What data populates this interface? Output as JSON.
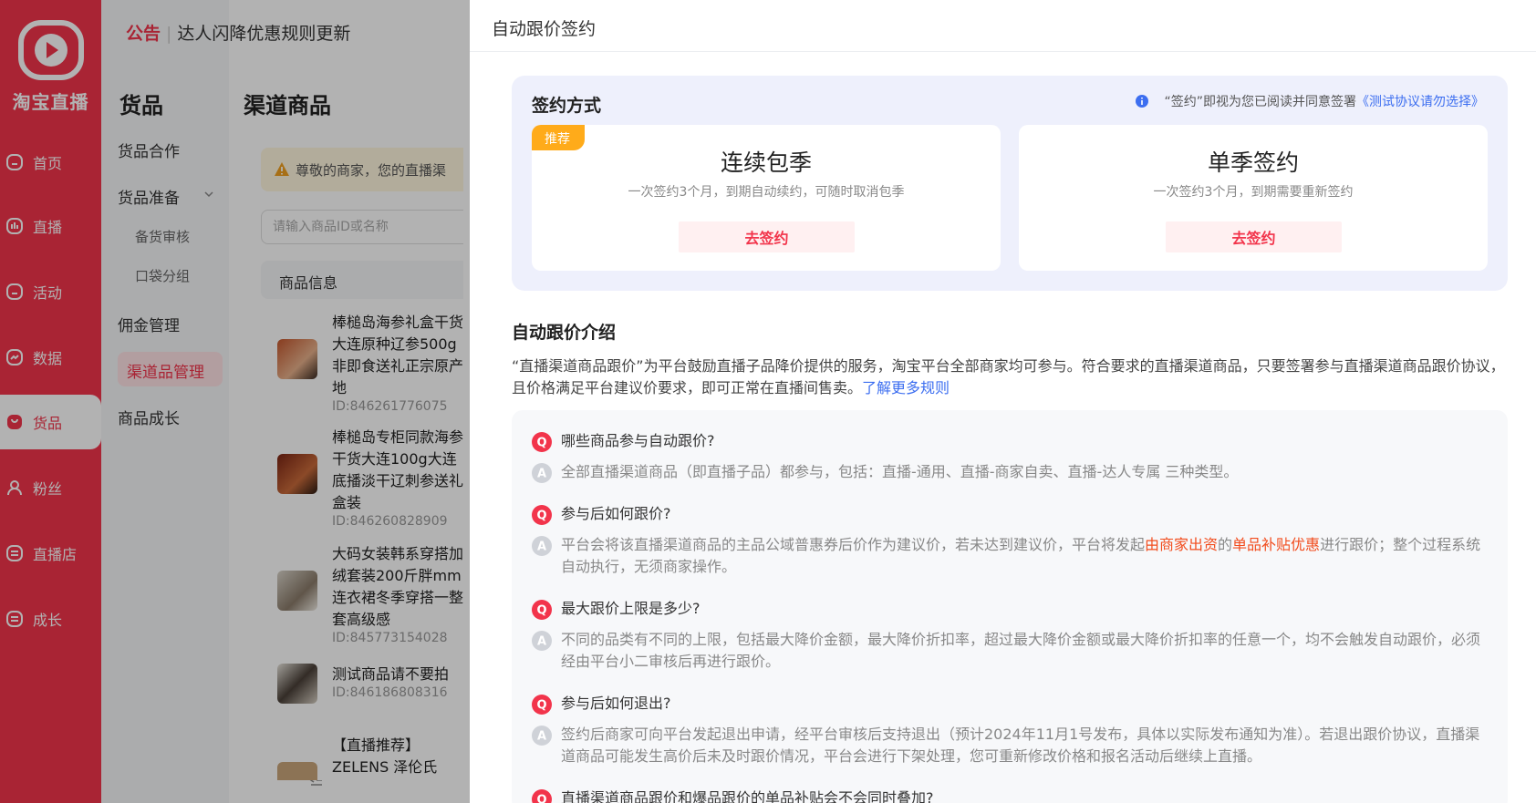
{
  "nav": {
    "brand": "淘宝直播",
    "items": [
      {
        "label": "首页",
        "icon": "home-icon"
      },
      {
        "label": "直播",
        "icon": "live-icon"
      },
      {
        "label": "活动",
        "icon": "activity-icon"
      },
      {
        "label": "数据",
        "icon": "data-icon"
      },
      {
        "label": "货品",
        "icon": "goods-icon"
      },
      {
        "label": "粉丝",
        "icon": "fans-icon"
      },
      {
        "label": "直播店",
        "icon": "store-icon"
      },
      {
        "label": "成长",
        "icon": "growth-icon"
      }
    ]
  },
  "sub": {
    "title": "货品",
    "items": [
      "货品合作",
      "货品准备",
      "备货审核",
      "口袋分组",
      "佣金管理",
      "渠道品管理",
      "商品成长"
    ]
  },
  "notice": {
    "tag": "公告",
    "text": "达人闪降优惠规则更新"
  },
  "middle": {
    "title": "渠道商品",
    "alert": "尊敬的商家，您的直播渠",
    "search_placeholder": "请输入商品ID或名称",
    "list_header": "商品信息",
    "products": [
      {
        "name": "棒槌岛海参礼盒干货大连原种辽参500g非即食送礼正宗原产地",
        "id": "ID:846261776075"
      },
      {
        "name": "棒槌岛专柜同款海参干货大连100g大连底播淡干辽刺参送礼盒装",
        "id": "ID:846260828909"
      },
      {
        "name": "大码女装韩系穿搭加绒套装200斤胖mm连衣裙冬季穿搭一整套高级感",
        "id": "ID:845773154028"
      },
      {
        "name": "测试商品请不要拍",
        "id": "ID:846186808316"
      },
      {
        "name": "【直播推荐】ZELENS 泽伦氏",
        "id": ""
      }
    ]
  },
  "drawer": {
    "title": "自动跟价签约",
    "sign_title": "签约方式",
    "agree_text": "“签约”即视为您已阅读并同意签署",
    "agree_link": "《测试协议请勿选择》",
    "cards": [
      {
        "badge": "推荐",
        "title": "连续包季",
        "desc": "一次签约3个月，到期自动续约，可随时取消包季",
        "button": "去签约"
      },
      {
        "badge": "",
        "title": "单季签约",
        "desc": "一次签约3个月，到期需要重新签约",
        "button": "去签约"
      }
    ],
    "intro_title": "自动跟价介绍",
    "intro_text": "“直播渠道商品跟价”为平台鼓励直播子品降价提供的服务，淘宝平台全部商家均可参与。符合要求的直播渠道商品，只要签署参与直播渠道商品跟价协议，且价格满足平台建议价要求，即可正常在直播间售卖。",
    "intro_link": "了解更多规则",
    "faq": [
      {
        "q": "哪些商品参与自动跟价?",
        "a": "全部直播渠道商品（即直播子品）都参与，包括：直播-通用、直播-商家自卖、直播-达人专属 三种类型。"
      },
      {
        "q": "参与后如何跟价?",
        "a_pre": "平台会将该直播渠道商品的主品公域普惠券后价作为建议价，若未达到建议价，平台将发起",
        "a_hl1": "由商家出资",
        "a_mid": "的",
        "a_hl2": "单品补贴优惠",
        "a_post": "进行跟价；整个过程系统自动执行，无须商家操作。"
      },
      {
        "q": "最大跟价上限是多少?",
        "a": "不同的品类有不同的上限，包括最大降价金额，最大降价折扣率，超过最大降价金额或最大降价折扣率的任意一个，均不会触发自动跟价，必须经由平台小二审核后再进行跟价。"
      },
      {
        "q": "参与后如何退出?",
        "a": "签约后商家可向平台发起退出申请，经平台审核后支持退出（预计2024年11月1号发布，具体以实际发布通知为准）。若退出跟价协议，直播渠道商品可能发生高价后未及时跟价情况，平台会进行下架处理，您可重新修改价格和报名活动后继续上直播。"
      },
      {
        "q": "直播渠道商品跟价和爆品跟价的单品补贴会不会同时叠加?",
        "a": ""
      }
    ]
  },
  "colors": {
    "brand": "#f2344b",
    "link": "#3c6ef0",
    "highlight": "#f24c1d",
    "badge": "#ffab1a"
  }
}
